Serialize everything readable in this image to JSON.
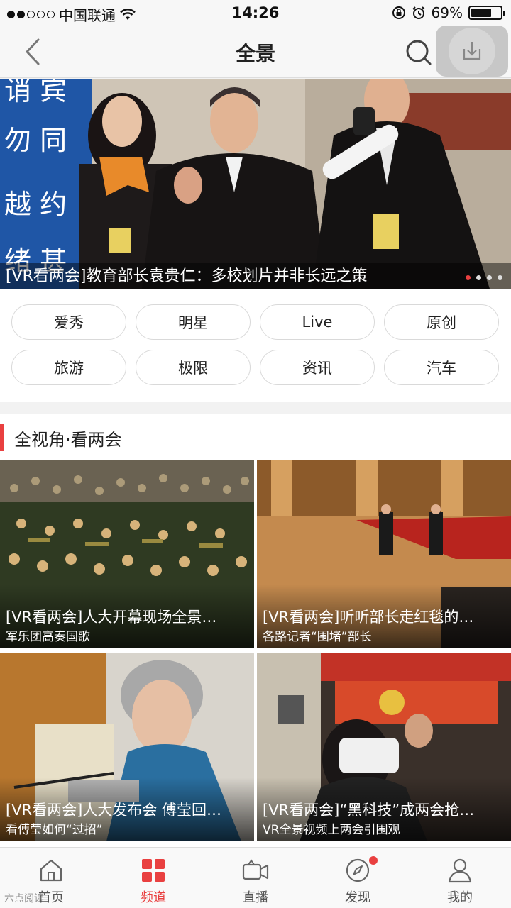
{
  "status_bar": {
    "carrier": "中国联通",
    "time": "14:26",
    "battery_percent": "69%",
    "battery_level": 0.69,
    "signal_dots_filled": 2,
    "signal_dots_total": 5
  },
  "nav": {
    "title": "全景",
    "icons": {
      "back": "chevron-left-icon",
      "search": "search-icon",
      "download": "download-icon"
    }
  },
  "banner": {
    "caption": "[VR看两会]教育部长袁贵仁：多校划片并非长远之策",
    "page_count": 4,
    "active_page": 1
  },
  "categories": [
    "爱秀",
    "明星",
    "Live",
    "原创",
    "旅游",
    "极限",
    "资讯",
    "汽车"
  ],
  "section": {
    "title": "全视角·看两会",
    "accent_color": "#e94040"
  },
  "cards": [
    {
      "title": "[VR看两会]人大开幕现场全景…",
      "subtitle": "军乐团高奏国歌"
    },
    {
      "title": "[VR看两会]听听部长走红毯的…",
      "subtitle": "各路记者“围堵”部长"
    },
    {
      "title": "[VR看两会]人大发布会 傅莹回…",
      "subtitle": "看傅莹如何“过招”"
    },
    {
      "title": "[VR看两会]“黑科技”成两会抢…",
      "subtitle": "VR全景视频上两会引围观"
    }
  ],
  "tab_bar": {
    "items": [
      {
        "label": "首页",
        "icon": "home-icon"
      },
      {
        "label": "频道",
        "icon": "grid-icon"
      },
      {
        "label": "直播",
        "icon": "video-camera-icon"
      },
      {
        "label": "发现",
        "icon": "compass-icon"
      },
      {
        "label": "我的",
        "icon": "user-icon"
      }
    ],
    "active_index": 1,
    "active_color": "#e94040"
  },
  "watermark": "六点阅读"
}
